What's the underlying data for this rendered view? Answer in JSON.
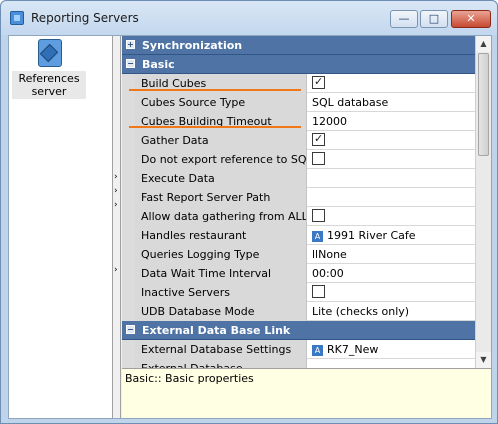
{
  "window": {
    "title": "Reporting Servers",
    "min_glyph": "—",
    "max_glyph": "□",
    "close_glyph": "✕"
  },
  "left_pane": {
    "items": [
      {
        "label_line1": "References",
        "label_line2": "server",
        "icon": "server-cube-icon"
      }
    ]
  },
  "splitter": {
    "arrow": "›"
  },
  "property_grid": {
    "categories": [
      {
        "label": "Synchronization",
        "expanded": false,
        "toggle_glyph": "+"
      },
      {
        "label": "Basic",
        "expanded": true,
        "toggle_glyph": "−"
      },
      {
        "label": "External Data Base Link",
        "expanded": true,
        "toggle_glyph": "−"
      }
    ],
    "basic_rows": [
      {
        "name": "Build Cubes",
        "value": "",
        "checkbox": true,
        "checked": true
      },
      {
        "name": "Cubes Source Type",
        "value": "SQL database"
      },
      {
        "name": "Cubes Building Timeout",
        "value": "12000"
      },
      {
        "name": "Gather Data",
        "value": "",
        "checkbox": true,
        "checked": true
      },
      {
        "name": "Do not export reference to SQL",
        "value": "",
        "checkbox": true,
        "checked": false
      },
      {
        "name": "Execute Data",
        "value": ""
      },
      {
        "name": "Fast Report Server Path",
        "value": ""
      },
      {
        "name": "Allow data gathering from ALL resta",
        "value": "",
        "checkbox": true,
        "checked": false
      },
      {
        "name": "Handles restaurant",
        "value": "1991 River Cafe",
        "badge": "A"
      },
      {
        "name": "Queries Logging Type",
        "value": "llNone"
      },
      {
        "name": "Data Wait Time Interval",
        "value": "00:00"
      },
      {
        "name": "Inactive Servers",
        "value": "",
        "checkbox": true,
        "checked": false
      },
      {
        "name": "UDB Database Mode",
        "value": "Lite (checks only)"
      }
    ],
    "external_rows": [
      {
        "name": "External Database Settings",
        "value": "RK7_New",
        "badge": "A"
      },
      {
        "name": "External Database ...",
        "value": ""
      }
    ]
  },
  "scrollbar": {
    "up_glyph": "▲",
    "down_glyph": "▼"
  },
  "description": {
    "text": "Basic:: Basic properties"
  },
  "colors": {
    "category_bg": "#4e73a4",
    "highlight_underline": "#f07818",
    "description_bg": "#ffffe4"
  }
}
